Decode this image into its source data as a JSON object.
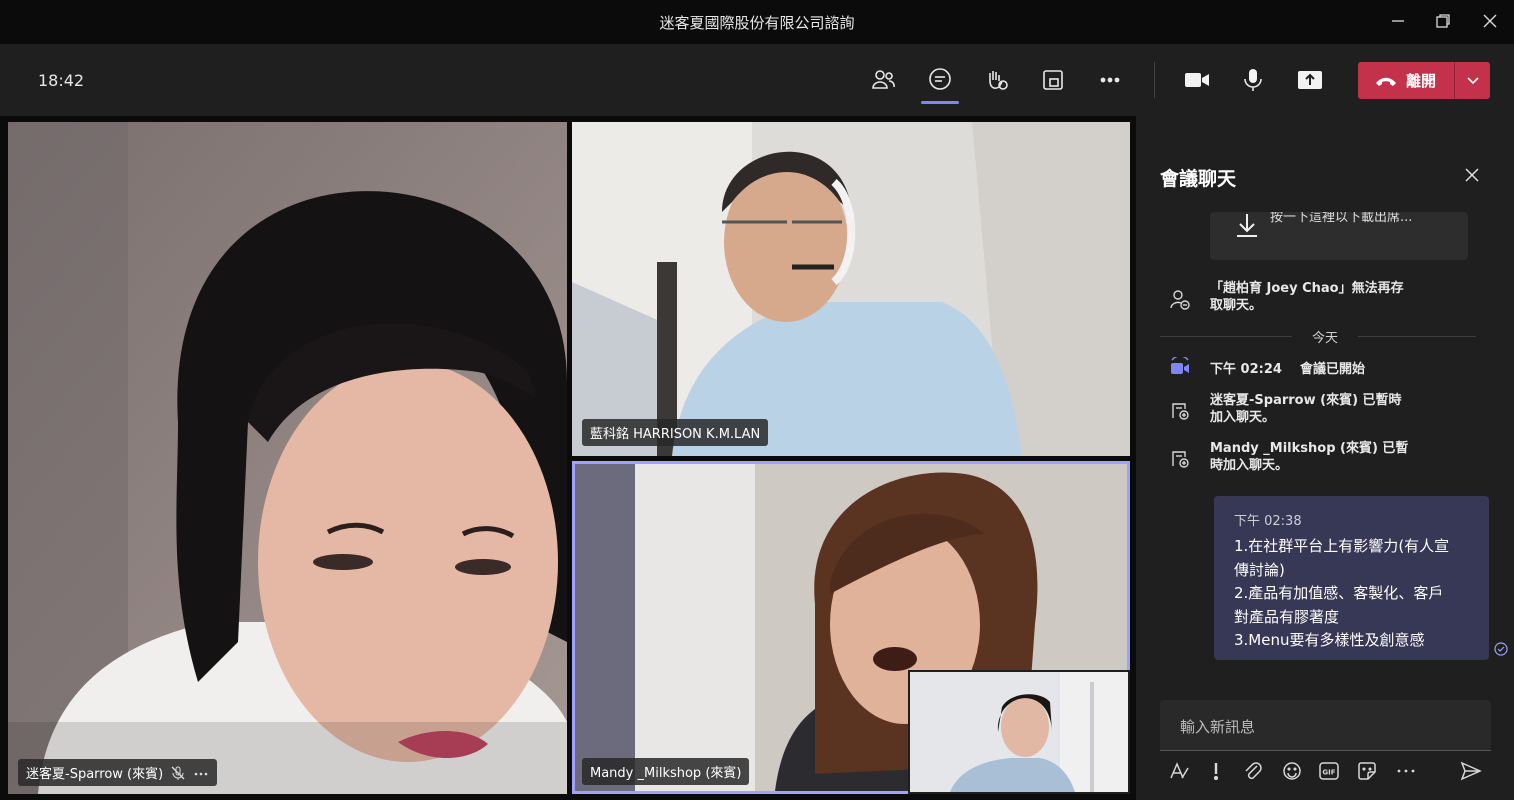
{
  "window": {
    "title": "迷客夏國際股份有限公司諮詢"
  },
  "toolbar": {
    "time": "18:42",
    "leave_label": "離開"
  },
  "participants": {
    "left": {
      "name": "迷客夏-Sparrow (來賓)"
    },
    "top_right": {
      "name": "藍科銘 HARRISON K.M.LAN"
    },
    "bottom_right": {
      "name": "Mandy _Milkshop (來賓)"
    }
  },
  "chat": {
    "title": "會議聊天",
    "download_card_text": "按一下這裡以下載出席...",
    "system_messages": [
      {
        "line1": "「趙柏育 Joey Chao」無法再存",
        "line2": "取聊天。"
      },
      {
        "line1": "迷客夏-Sparrow (來賓) 已暫時",
        "line2": "加入聊天。"
      },
      {
        "line1": "Mandy _Milkshop (來賓) 已暫",
        "line2": "時加入聊天。"
      }
    ],
    "divider_label": "今天",
    "meeting_started": {
      "time": "下午 02:24",
      "text": "會議已開始"
    },
    "message": {
      "time": "下午 02:38",
      "lines": [
        "1.在社群平台上有影響力(有人宣",
        "傳討論)",
        "2.產品有加值感、客製化、客戶",
        "對產品有膠著度",
        "3.Menu要有多樣性及創意感"
      ]
    },
    "input_placeholder": "輸入新訊息"
  },
  "colors": {
    "accent": "#7f85f5",
    "leave": "#c4314b",
    "bubble": "#373756",
    "panel": "#1f1f1f"
  }
}
